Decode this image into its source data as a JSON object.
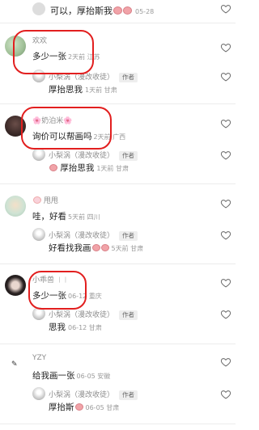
{
  "top_reply": {
    "text": "可以，厚抬斯我",
    "meta": "05-28"
  },
  "comments": [
    {
      "username": "欢欢",
      "text": "多少一张",
      "meta": "2天前 江苏",
      "reply": {
        "name": "小梨涡（漫改收徒）",
        "badge": "作者",
        "text": "厚抬思我",
        "meta": "1天前 甘肃"
      }
    },
    {
      "username": "🌸奶泊米🌸",
      "text": "询价可以帮画吗",
      "meta": "2天前 广西",
      "reply": {
        "name": "小梨涡（漫改收徒）",
        "badge": "作者",
        "text": "厚抬思我",
        "meta": "1天前 甘肃"
      }
    },
    {
      "username": "甩甩",
      "text": "哇，好看",
      "meta": "5天前 四川",
      "reply": {
        "name": "小梨涡（漫改收徒）",
        "badge": "作者",
        "text": "好看找我画",
        "meta": "5天前 甘肃"
      }
    },
    {
      "username": "小乖兽",
      "text": "多少一张",
      "meta": "06-12 重庆",
      "reply": {
        "name": "小梨涡（漫改收徒）",
        "badge": "作者",
        "text": "思我",
        "meta": "06-12 甘肃"
      }
    },
    {
      "username": "YZY",
      "text": "给我画一张",
      "meta": "06-05 安徽",
      "reply": {
        "name": "小梨涡（漫改收徒）",
        "badge": "作者",
        "text": "厚抬斯",
        "meta": "06-05 甘肃"
      }
    }
  ],
  "icons": {
    "like": "heart-outline-icon"
  },
  "colors": {
    "annotation": "#e21f1f",
    "meta": "#9a9a9a",
    "username": "#8d8d8d"
  }
}
